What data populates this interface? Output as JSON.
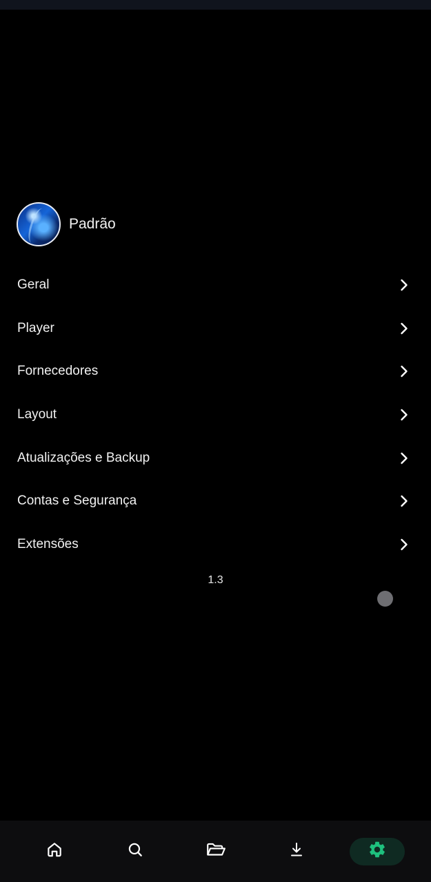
{
  "profile": {
    "name": "Padrão"
  },
  "menu": {
    "items": [
      {
        "label": "Geral"
      },
      {
        "label": "Player"
      },
      {
        "label": "Fornecedores"
      },
      {
        "label": "Layout"
      },
      {
        "label": "Atualizações e Backup"
      },
      {
        "label": "Contas e Segurança"
      },
      {
        "label": "Extensões"
      }
    ]
  },
  "version": "1.3",
  "bottom_nav": {
    "items": [
      {
        "icon": "home-icon",
        "active": false
      },
      {
        "icon": "search-icon",
        "active": false
      },
      {
        "icon": "folder-open-icon",
        "active": false
      },
      {
        "icon": "download-icon",
        "active": false
      },
      {
        "icon": "gear-icon",
        "active": true
      }
    ]
  },
  "colors": {
    "background": "#000000",
    "accent": "#1ec07e",
    "nav_background": "#0d0d0f",
    "active_pill": "#0f2a22"
  }
}
